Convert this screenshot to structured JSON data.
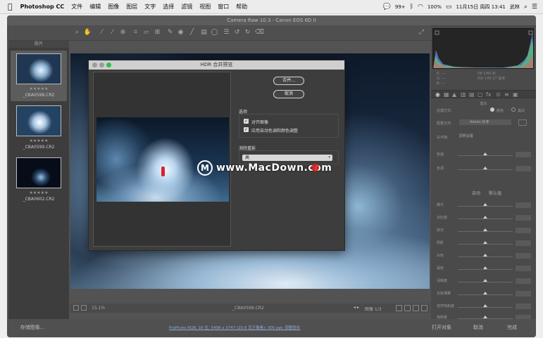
{
  "menubar": {
    "apple": "",
    "app_name": "Photoshop CC",
    "items": [
      "文件",
      "编辑",
      "图像",
      "图层",
      "文字",
      "选择",
      "滤镜",
      "视图",
      "窗口",
      "帮助"
    ],
    "status": {
      "notifications": "99+",
      "battery": "100%",
      "datetime": "11月15日 周四 13:41",
      "user": "武林"
    }
  },
  "window": {
    "title": "Camera Raw 10.3 - Canon EOS 6D II"
  },
  "filmstrip": {
    "header": "胶片",
    "items": [
      {
        "filename": "_CBA0598.CR2",
        "stars": "★★★★★"
      },
      {
        "filename": "_CBA0599.CR2",
        "stars": "★★★★★"
      },
      {
        "filename": "_CBA0602.CR2",
        "stars": "★★★★★"
      }
    ]
  },
  "statusbar": {
    "zoom": "15.1%",
    "filename": "_CBA0598.CR2",
    "image_counter": "图像 1/3"
  },
  "bottombar": {
    "save_label": "存储图像...",
    "workflow_link": "ProPhoto RGB; 16 位; 5498 x 3747 (20.6 百万像素); 300 ppi; 调整锐化",
    "open_label": "打开对象",
    "cancel_label": "取消",
    "done_label": "完成"
  },
  "right_panel": {
    "section_title": "基本",
    "hist_r": "R:",
    "hist_g": "G:",
    "hist_b": "B:",
    "hist_values": "---",
    "exif_left": "f/8 1/60 秒",
    "exif_right": "ISO 100 17 毫米",
    "treatment_label": "处理方式:",
    "treatment_color": "颜色",
    "treatment_bw": "黑白",
    "profile_label": "配置文件:",
    "profile_value": "Adobe 标准",
    "wb_label": "白平衡:",
    "wb_value": "原照设置",
    "auto_label": "自动",
    "default_label": "默认值",
    "sliders": [
      "色温",
      "色调",
      "曝光",
      "对比度",
      "高光",
      "阴影",
      "白色",
      "黑色",
      "清晰度",
      "去除薄雾",
      "自然饱和度",
      "饱和度"
    ],
    "slider_positions": [
      0.5,
      0.5,
      0.5,
      0.5,
      0.5,
      0.5,
      0.5,
      0.5,
      0.5,
      0.5,
      0.5,
      0.5
    ]
  },
  "dialog": {
    "title": "HDR 合并预览",
    "merge_button": "合并...",
    "cancel_button": "取消",
    "options_title": "选项",
    "option_align": "对齐图像",
    "option_auto_tone": "应用自动色调和颜色调整",
    "option_align_checked": true,
    "option_auto_tone_checked": true,
    "deghost_title": "消除重影",
    "deghost_value": "高"
  },
  "watermark": {
    "icon": "M",
    "text": "www.MacDown.com"
  }
}
